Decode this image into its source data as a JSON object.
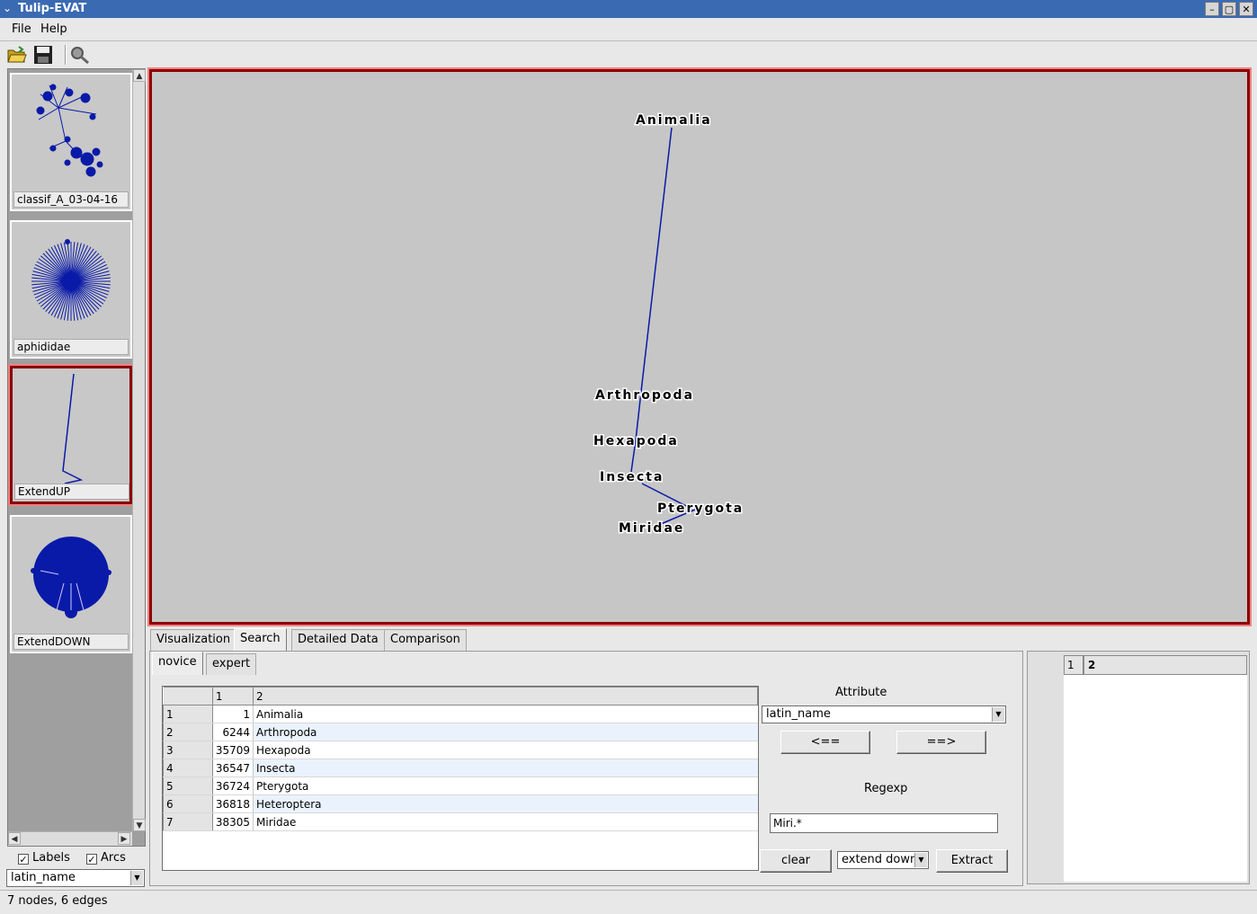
{
  "window": {
    "title": "Tulip-EVAT"
  },
  "menubar": {
    "items": [
      {
        "label": "File"
      },
      {
        "label": "Help"
      }
    ]
  },
  "toolbar": {
    "icons": [
      "open-folder-icon",
      "save-icon",
      "search-magnifier-icon"
    ]
  },
  "graphs": [
    {
      "label": "classif_A_03-04-16"
    },
    {
      "label": "aphididae"
    },
    {
      "label": "ExtendUP",
      "selected": true
    },
    {
      "label": "ExtendDOWN"
    }
  ],
  "left_controls": {
    "labels_checkbox": {
      "label": "Labels",
      "checked": true
    },
    "arcs_checkbox": {
      "label": "Arcs",
      "checked": true
    },
    "attribute_select": "latin_name"
  },
  "canvas": {
    "nodes": [
      "Animalia",
      "Arthropoda",
      "Hexapoda",
      "Insecta",
      "Pterygota",
      "Miridae"
    ],
    "edge_color": "#0a1aa8",
    "background": "#c6c6c6"
  },
  "main_tabs": [
    "Visualization",
    "Search",
    "Detailed Data",
    "Comparison"
  ],
  "active_main_tab": "Search",
  "sub_tabs": [
    "novice",
    "expert"
  ],
  "active_sub_tab": "novice",
  "results_table": {
    "headers": [
      "1",
      "2"
    ],
    "rows": [
      {
        "row": "1",
        "id": "1",
        "name": "Animalia"
      },
      {
        "row": "2",
        "id": "6244",
        "name": "Arthropoda"
      },
      {
        "row": "3",
        "id": "35709",
        "name": "Hexapoda"
      },
      {
        "row": "4",
        "id": "36547",
        "name": "Insecta"
      },
      {
        "row": "5",
        "id": "36724",
        "name": "Pterygota"
      },
      {
        "row": "6",
        "id": "36818",
        "name": "Heteroptera"
      },
      {
        "row": "7",
        "id": "38305",
        "name": "Miridae"
      }
    ]
  },
  "search_panel": {
    "attribute_label": "Attribute",
    "attribute_value": "latin_name",
    "left_button": "<==",
    "right_button": "==>",
    "regexp_label": "Regexp",
    "regexp_value": "Miri.*",
    "clear_button": "clear",
    "mode_select": "extend down",
    "extract_button": "Extract"
  },
  "right_table": {
    "headers": [
      "1",
      "2"
    ]
  },
  "status": {
    "text": "7 nodes, 6 edges"
  }
}
